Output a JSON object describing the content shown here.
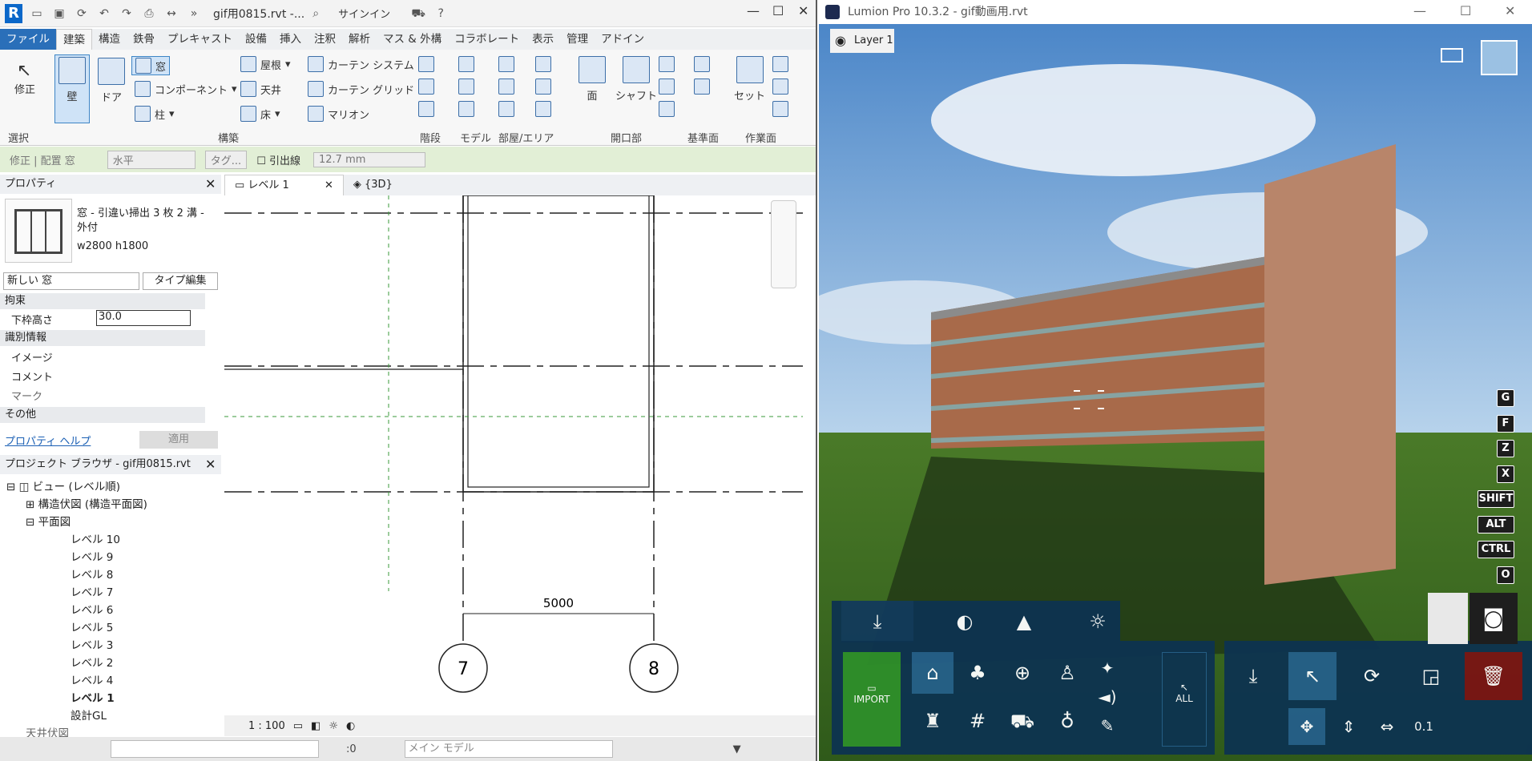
{
  "revit": {
    "qat_title": "gif用0815.rvt -...",
    "signin": "サインイン",
    "tabs": [
      "ファイル",
      "建築",
      "構造",
      "鉄骨",
      "プレキャスト",
      "設備",
      "挿入",
      "注釈",
      "解析",
      "マス & 外構",
      "コラボレート",
      "表示",
      "管理",
      "アドイン"
    ],
    "ribbon": {
      "modify": "修正",
      "wall": "壁",
      "door": "ドア",
      "window": "窓",
      "component": "コンポーネント",
      "column": "柱",
      "roof": "屋根",
      "ceiling": "天井",
      "floor": "床",
      "curtain_system": "カーテン システム",
      "curtain_grid": "カーテン グリッド",
      "mullion": "マリオン",
      "face": "面",
      "shaft": "シャフト",
      "set": "セット",
      "groups": [
        "選択",
        "構築",
        "階段",
        "モデル",
        "部屋/エリア",
        "開口部",
        "基準面",
        "作業面"
      ]
    },
    "options": {
      "context": "修正 | 配置 窓",
      "orientation": "水平",
      "tag": "タグ...",
      "leader": "引出線",
      "dimension": "12.7 mm"
    },
    "properties": {
      "title": "プロパティ",
      "type_name": "窓 - 引違い掃出 3 枚 2 溝 - 外付",
      "type_size": "w2800 h1800",
      "selector": "新しい 窓",
      "edit_type": "タイプ編集",
      "sections": [
        {
          "name": "拘束",
          "rows": [
            {
              "label": "下枠高さ",
              "value": "30.0"
            }
          ]
        },
        {
          "name": "識別情報",
          "rows": [
            {
              "label": "イメージ",
              "value": ""
            },
            {
              "label": "コメント",
              "value": ""
            },
            {
              "label": "マーク",
              "value": ""
            }
          ]
        },
        {
          "name": "その他",
          "rows": []
        }
      ],
      "help": "プロパティ ヘルプ",
      "apply": "適用"
    },
    "browser": {
      "title": "プロジェクト ブラウザ - gif用0815.rvt",
      "root": "ビュー (レベル順)",
      "struct": "構造伏図 (構造平面図)",
      "plan": "平面図",
      "levels": [
        "レベル 10",
        "レベル 9",
        "レベル 8",
        "レベル 7",
        "レベル 6",
        "レベル 5",
        "レベル 3",
        "レベル 2",
        "レベル 4",
        "レベル 1",
        "設計GL"
      ],
      "ceiling": "天井伏図"
    },
    "view_tabs": {
      "level1": "レベル 1",
      "three_d": "{3D}"
    },
    "drawing": {
      "dimension": "5000",
      "grid_left": "7",
      "grid_right": "8"
    },
    "statusbar": {
      "scale": "1 : 100"
    },
    "bottom": {
      "zero": ":0",
      "model": "メイン モデル"
    }
  },
  "lumion": {
    "title": "Lumion Pro 10.3.2 - gif動画用.rvt",
    "layer": "Layer 1",
    "keys": [
      "G",
      "F",
      "Z",
      "X",
      "SHIFT",
      "ALT",
      "CTRL",
      "O"
    ],
    "import": "IMPORT",
    "all": "ALL",
    "height": "0.1"
  },
  "colors": {
    "revit_blue": "#2a6fb9",
    "lumion_panel": "#0d3350",
    "import_green": "#2e8f2a",
    "delete_red": "#7a1414"
  }
}
